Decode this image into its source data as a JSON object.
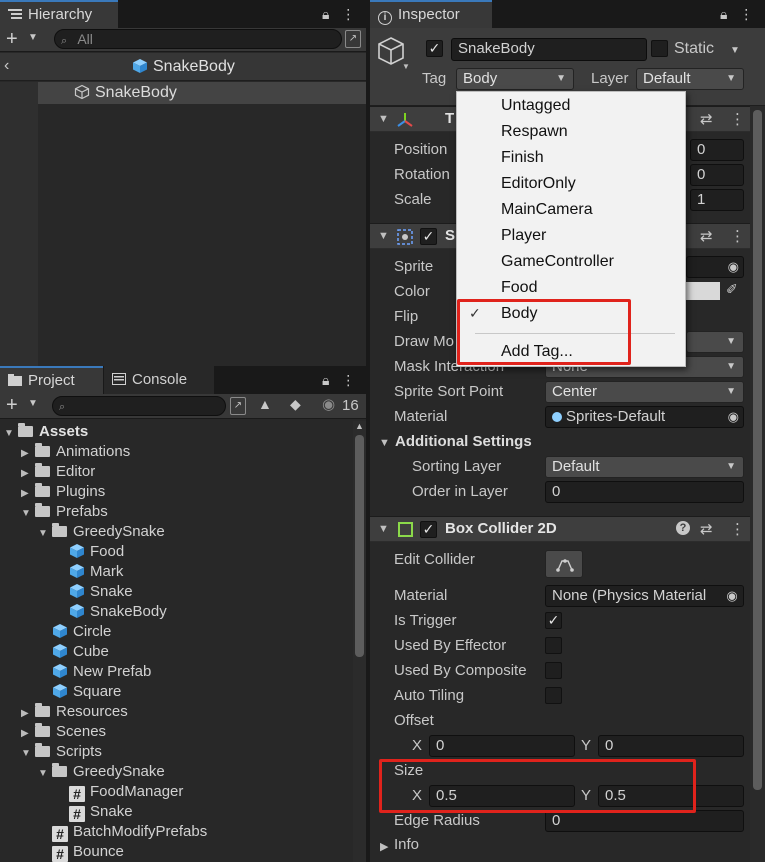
{
  "hierarchy": {
    "tab": "Hierarchy",
    "search_placeholder": "All",
    "breadcrumb": "SnakeBody",
    "items": [
      {
        "label": "SnakeBody"
      }
    ]
  },
  "project": {
    "tabs": [
      "Project",
      "Console"
    ],
    "hidden_count": "16",
    "tree": [
      {
        "label": "Assets",
        "level": 0,
        "kind": "folder",
        "expanded": true,
        "bold": true
      },
      {
        "label": "Animations",
        "level": 1,
        "kind": "folder",
        "expanded": false
      },
      {
        "label": "Editor",
        "level": 1,
        "kind": "folder",
        "expanded": false
      },
      {
        "label": "Plugins",
        "level": 1,
        "kind": "folder",
        "expanded": false
      },
      {
        "label": "Prefabs",
        "level": 1,
        "kind": "folder",
        "expanded": true
      },
      {
        "label": "GreedySnake",
        "level": 2,
        "kind": "folder",
        "expanded": true
      },
      {
        "label": "Food",
        "level": 3,
        "kind": "prefab"
      },
      {
        "label": "Mark",
        "level": 3,
        "kind": "prefab"
      },
      {
        "label": "Snake",
        "level": 3,
        "kind": "prefab"
      },
      {
        "label": "SnakeBody",
        "level": 3,
        "kind": "prefab"
      },
      {
        "label": "Circle",
        "level": 2,
        "kind": "prefab"
      },
      {
        "label": "Cube",
        "level": 2,
        "kind": "prefab"
      },
      {
        "label": "New Prefab",
        "level": 2,
        "kind": "prefab"
      },
      {
        "label": "Square",
        "level": 2,
        "kind": "prefab"
      },
      {
        "label": "Resources",
        "level": 1,
        "kind": "folder",
        "expanded": false
      },
      {
        "label": "Scenes",
        "level": 1,
        "kind": "folder",
        "expanded": false
      },
      {
        "label": "Scripts",
        "level": 1,
        "kind": "folder",
        "expanded": true
      },
      {
        "label": "GreedySnake",
        "level": 2,
        "kind": "folder",
        "expanded": true
      },
      {
        "label": "FoodManager",
        "level": 3,
        "kind": "script"
      },
      {
        "label": "Snake",
        "level": 3,
        "kind": "script"
      },
      {
        "label": "BatchModifyPrefabs",
        "level": 2,
        "kind": "script"
      },
      {
        "label": "Bounce",
        "level": 2,
        "kind": "script"
      }
    ]
  },
  "inspector": {
    "tab": "Inspector",
    "object_name": "SnakeBody",
    "static_label": "Static",
    "tag_label": "Tag",
    "tag_value": "Body",
    "layer_label": "Layer",
    "layer_value": "Default",
    "transform": {
      "title": "T",
      "position_label": "Position",
      "rotation_label": "Rotation",
      "scale_label": "Scale",
      "position_z": "0",
      "rotation_z": "0",
      "scale_z": "1"
    },
    "sprite_renderer": {
      "title": "S",
      "sprite_label": "Sprite",
      "color_label": "Color",
      "flip_label": "Flip",
      "draw_mode_label": "Draw Mo",
      "mask_label": "Mask Interaction",
      "mask_value": "None",
      "sort_point_label": "Sprite Sort Point",
      "sort_point_value": "Center",
      "material_label": "Material",
      "material_value": "Sprites-Default",
      "additional_label": "Additional Settings",
      "sorting_layer_label": "Sorting Layer",
      "sorting_layer_value": "Default",
      "order_label": "Order in Layer",
      "order_value": "0"
    },
    "box_collider": {
      "title": "Box Collider 2D",
      "edit_label": "Edit Collider",
      "material_label": "Material",
      "material_value": "None (Physics Material",
      "is_trigger_label": "Is Trigger",
      "used_by_effector_label": "Used By Effector",
      "used_by_composite_label": "Used By Composite",
      "auto_tiling_label": "Auto Tiling",
      "offset_label": "Offset",
      "offset_x": "0",
      "offset_y": "0",
      "size_label": "Size",
      "size_x": "0.5",
      "size_y": "0.5",
      "x_label": "X",
      "y_label": "Y",
      "edge_radius_label": "Edge Radius",
      "edge_radius_value": "0",
      "info_label": "Info"
    }
  },
  "tag_popup": {
    "options": [
      "Untagged",
      "Respawn",
      "Finish",
      "EditorOnly",
      "MainCamera",
      "Player",
      "GameController",
      "Food",
      "Body"
    ],
    "selected": "Body",
    "add_tag": "Add Tag..."
  }
}
